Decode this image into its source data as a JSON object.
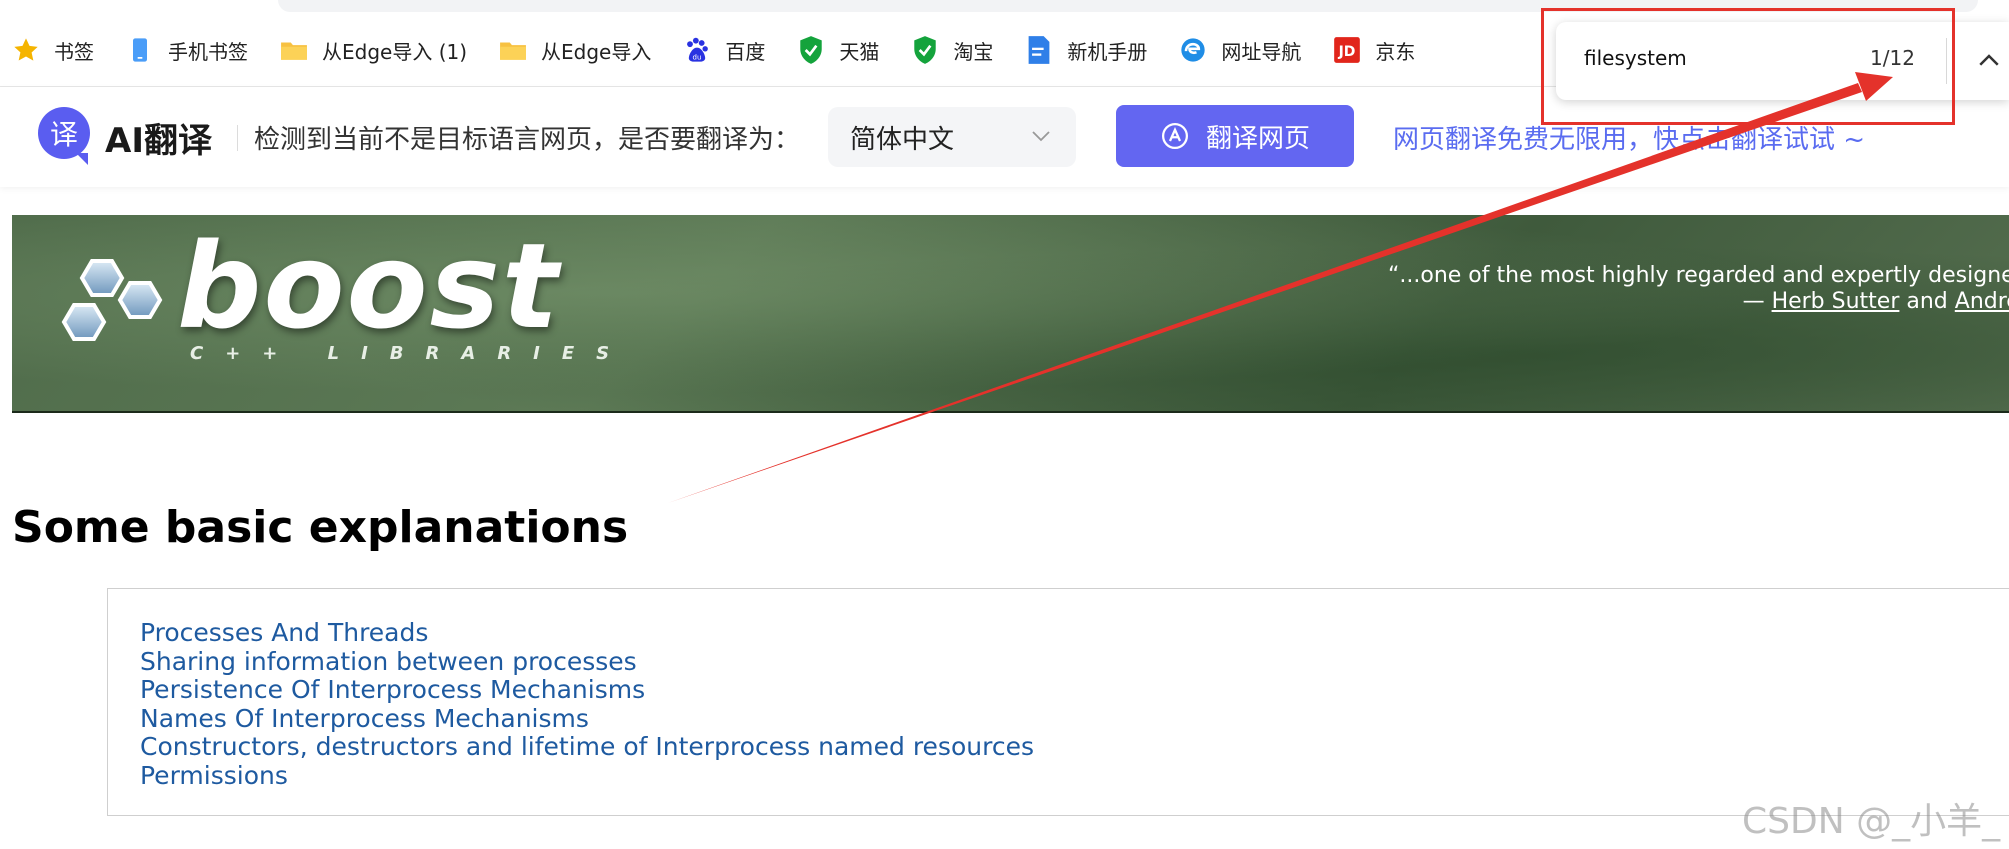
{
  "bookmarks": [
    {
      "label": "书签",
      "icon": "star-icon"
    },
    {
      "label": "手机书签",
      "icon": "phone-icon"
    },
    {
      "label": "从Edge导入 (1)",
      "icon": "folder-icon"
    },
    {
      "label": "从Edge导入",
      "icon": "folder-icon"
    },
    {
      "label": "百度",
      "icon": "baidu-icon"
    },
    {
      "label": "天猫",
      "icon": "shield-check-icon"
    },
    {
      "label": "淘宝",
      "icon": "shield-check-icon"
    },
    {
      "label": "新机手册",
      "icon": "document-icon"
    },
    {
      "label": "网址导航",
      "icon": "edge-icon"
    },
    {
      "label": "京东",
      "icon": "jd-icon"
    }
  ],
  "translate_bar": {
    "logo_glyph": "译",
    "title": "AI翻译",
    "question": "检测到当前不是目标语言网页，是否要翻译为：",
    "language": "简体中文",
    "button_label": "翻译网页",
    "promo": "网页翻译免费无限用，快点击翻译试试 ~"
  },
  "banner": {
    "logo_word": "boost",
    "logo_sub": "C++ LIBRARIES",
    "quote": "“...one of the most highly regarded and expertly designed C",
    "attr_prefix": "— ",
    "author1": "Herb Sutter",
    "attr_and": " and ",
    "author2": "Andrei A"
  },
  "content": {
    "heading": "Some basic explanations",
    "toc": [
      "Processes And Threads",
      "Sharing information between processes",
      "Persistence Of Interprocess Mechanisms",
      "Names Of Interprocess Mechanisms",
      "Constructors, destructors and lifetime of Interprocess named resources",
      "Permissions"
    ]
  },
  "find_bar": {
    "query": "filesystem",
    "count": "1/12"
  },
  "watermark": "CSDN @_小羊_",
  "colors": {
    "accent": "#6366f1",
    "link": "#1e5aa0",
    "annotation": "#e4322b"
  }
}
